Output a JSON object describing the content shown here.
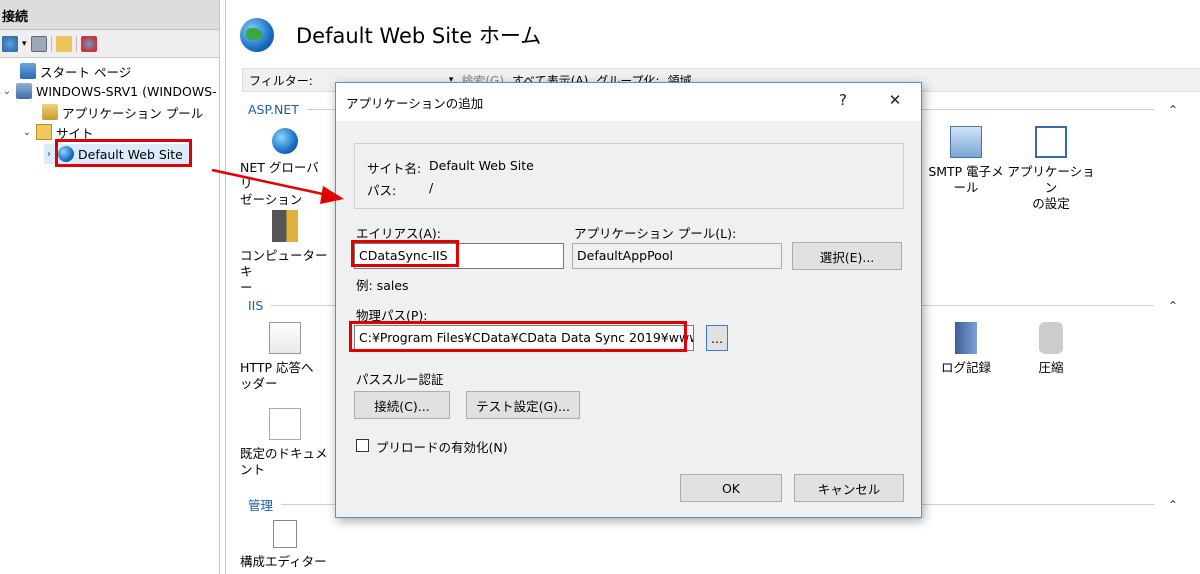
{
  "left_pane": {
    "header": "接続",
    "tree": {
      "start_page": "スタート ページ",
      "server": "WINDOWS-SRV1 (WINDOWS-",
      "app_pools": "アプリケーション プール",
      "sites": "サイト",
      "default_site": "Default Web Site"
    }
  },
  "main": {
    "title": "Default Web Site ホーム",
    "filter_label": "フィルター:",
    "filter_search": "検索(G)",
    "filter_show_all": "すべて表示(A)",
    "filter_group": "グループ化:",
    "filter_group_value": "領域",
    "sections": {
      "aspnet": "ASP.NET",
      "iis": "IIS",
      "manage": "管理"
    },
    "features": {
      "net_globalization": "NET グローバリ\nゼーション",
      "machine_key": "コンピューター キ\nー",
      "smtp": "SMTP 電子メ\nール",
      "app_settings": "アプリケーション\nの設定",
      "http_headers": "HTTP 応答へ\nッダー",
      "default_doc": "既定のドキュメ\nント",
      "logging": "ログ記録",
      "compression": "圧縮",
      "config_editor": "構成エディター"
    }
  },
  "dialog": {
    "title": "アプリケーションの追加",
    "help": "?",
    "close": "✕",
    "site_name_label": "サイト名:",
    "site_name_value": "Default Web Site",
    "path_label": "パス:",
    "path_value": "/",
    "alias_label": "エイリアス(A):",
    "alias_value": "CDataSync-IIS",
    "alias_example": "例: sales",
    "app_pool_label": "アプリケーション プール(L):",
    "app_pool_value": "DefaultAppPool",
    "select_button": "選択(E)...",
    "physical_path_label": "物理パス(P):",
    "physical_path_value": "C:¥Program Files¥CData¥CData Data Sync 2019¥www",
    "browse_button": "...",
    "passthrough_label": "パススルー認証",
    "connect_as_button": "接続(C)...",
    "test_settings_button": "テスト設定(G)...",
    "preload_label": "プリロードの有効化(N)",
    "ok_button": "OK",
    "cancel_button": "キャンセル"
  },
  "colors": {
    "highlight": "#e00000",
    "section_header": "#1f5fa8",
    "dialog_border": "#5a8fd6"
  }
}
